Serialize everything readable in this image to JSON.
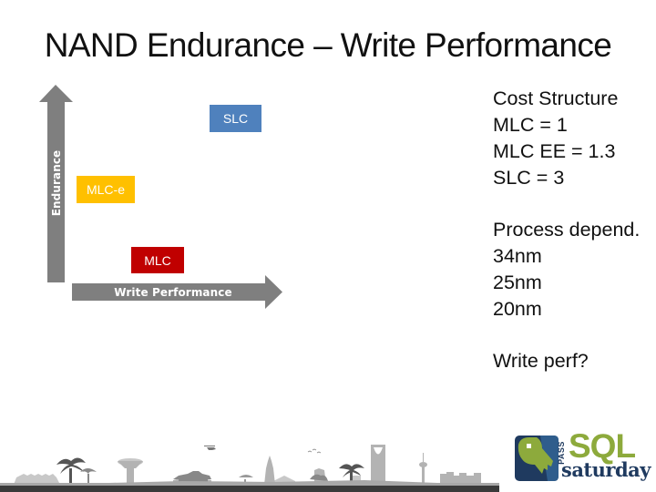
{
  "slide": {
    "title": "NAND Endurance – Write Performance"
  },
  "diagram": {
    "y_axis_label": "Endurance",
    "x_axis_label": "Write Performance",
    "boxes": [
      {
        "label": "SLC",
        "color": "#4F81BD"
      },
      {
        "label": "MLC-e",
        "color": "#FFC000"
      },
      {
        "label": "MLC",
        "color": "#C00000"
      }
    ],
    "arrow_color": "#7F7F7F"
  },
  "notes": {
    "cost_structure": {
      "heading": "Cost Structure",
      "lines": [
        "MLC = 1",
        "MLC EE = 1.3",
        "SLC = 3"
      ]
    },
    "process": {
      "heading": "Process depend.",
      "lines": [
        "34nm",
        "25nm",
        "20nm"
      ]
    },
    "question": "Write perf?"
  },
  "footer": {
    "logo": {
      "pass": "PASS",
      "sql": "SQL",
      "saturday": "saturday",
      "icon": "key-icon",
      "colors": {
        "green": "#8DAA3C",
        "navy": "#1F3A5F"
      }
    },
    "skyline": "city-skyline-banner"
  }
}
